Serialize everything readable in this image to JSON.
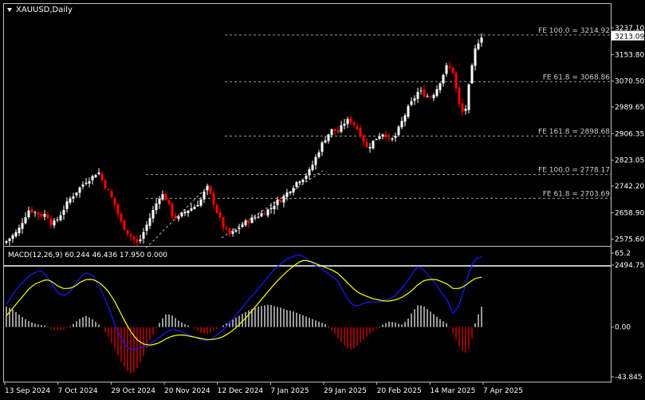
{
  "symbol_label": "XAUUSD,Daily",
  "macd_label": "MACD(12,26,9) 60.244 46.436 17.950 0.000",
  "colors": {
    "background": "#000000",
    "frame": "#c0c0c0",
    "text": "#ffffff",
    "bull_candle": "#ffffff",
    "bear_candle": "#ff0000",
    "fib_line": "#9a9a9a",
    "macd_line": "#1a1aff",
    "signal_line": "#ffff00",
    "hist_positive": "#ffffff",
    "hist_negative": "#ff0000",
    "price_label_bg": "#ffffff",
    "price_label_text": "#000000"
  },
  "chart_data": {
    "type": "candlestick",
    "price_axis": {
      "ticks": [
        "3237.10",
        "3153.80",
        "3070.50",
        "2989.65",
        "2906.35",
        "2823.05",
        "2742.20",
        "2658.90",
        "2575.60",
        "2494.75"
      ],
      "ylim": [
        2494.75,
        3237.1
      ]
    },
    "current_price": "3213.09",
    "x_axis_labels": [
      "13 Sep 2024",
      "7 Oct 2024",
      "29 Oct 2024",
      "20 Nov 2024",
      "12 Dec 2024",
      "7 Jan 2025",
      "29 Jan 2025",
      "20 Feb 2025",
      "14 Mar 2025",
      "7 Apr 2025"
    ],
    "fib_levels": [
      {
        "label": "FE 100.0 = 3214.92",
        "value": 3214.92
      },
      {
        "label": "FE 61.8 = 3068.86",
        "value": 3068.86
      },
      {
        "label": "FE 161.8 = 2898.68",
        "value": 2898.68
      },
      {
        "label": "FE 100.0 = 2778.17",
        "value": 2778.17
      },
      {
        "label": "FE 61.8 = 2703.69",
        "value": 2703.69
      }
    ],
    "close_path": [
      2570,
      2585,
      2600,
      2640,
      2670,
      2660,
      2650,
      2655,
      2620,
      2640,
      2670,
      2700,
      2720,
      2740,
      2760,
      2770,
      2790,
      2750,
      2720,
      2680,
      2630,
      2600,
      2580,
      2560,
      2600,
      2640,
      2680,
      2720,
      2700,
      2650,
      2640,
      2660,
      2670,
      2680,
      2700,
      2740,
      2700,
      2650,
      2610,
      2590,
      2600,
      2620,
      2630,
      2640,
      2650,
      2660,
      2670,
      2690,
      2700,
      2720,
      2740,
      2760,
      2770,
      2790,
      2830,
      2870,
      2900,
      2920,
      2910,
      2940,
      2950,
      2930,
      2900,
      2860,
      2880,
      2900,
      2910,
      2880,
      2900,
      2940,
      2980,
      3010,
      3040,
      3030,
      3020,
      3040,
      3080,
      3120,
      3100,
      3000,
      2960,
      3080,
      3180,
      3213
    ],
    "macd": {
      "ticks": [
        "65.2",
        "0.00",
        "-43.845"
      ],
      "ylim": [
        -43.845,
        65.2
      ],
      "hist_path": [
        18,
        16,
        12,
        8,
        5,
        3,
        2,
        1,
        -2,
        -3,
        -2,
        0,
        4,
        8,
        10,
        7,
        3,
        -2,
        -10,
        -20,
        -30,
        -38,
        -42,
        -35,
        -25,
        -12,
        -3,
        6,
        12,
        10,
        6,
        3,
        1,
        -2,
        -5,
        -6,
        -4,
        -1,
        2,
        5,
        8,
        11,
        14,
        16,
        18,
        19,
        20,
        18,
        17,
        15,
        14,
        12,
        10,
        8,
        6,
        4,
        2,
        -4,
        -10,
        -16,
        -20,
        -18,
        -13,
        -8,
        -4,
        0,
        3,
        5,
        4,
        2,
        6,
        14,
        20,
        18,
        14,
        10,
        6,
        3,
        -6,
        -16,
        -24,
        -18,
        6,
        18
      ],
      "macd_path": [
        20,
        28,
        35,
        40,
        45,
        48,
        50,
        45,
        38,
        30,
        28,
        30,
        38,
        44,
        48,
        46,
        38,
        28,
        15,
        2,
        -10,
        -18,
        -20,
        -19,
        -17,
        -15,
        -12,
        -8,
        -4,
        -2,
        -3,
        -5,
        -7,
        -9,
        -11,
        -12,
        -10,
        -6,
        -2,
        4,
        10,
        16,
        22,
        28,
        34,
        40,
        46,
        52,
        56,
        60,
        62,
        64,
        62,
        58,
        54,
        52,
        48,
        44,
        40,
        30,
        22,
        18,
        20,
        22,
        22,
        22,
        23,
        25,
        28,
        34,
        40,
        48,
        54,
        50,
        44,
        38,
        30,
        24,
        12,
        18,
        34,
        52,
        60,
        62
      ],
      "signal_path": [
        10,
        16,
        22,
        28,
        34,
        38,
        40,
        42,
        40,
        36,
        34,
        34,
        36,
        40,
        42,
        42,
        40,
        36,
        30,
        22,
        12,
        2,
        -6,
        -12,
        -15,
        -16,
        -15,
        -13,
        -10,
        -8,
        -7,
        -7,
        -8,
        -9,
        -10,
        -11,
        -11,
        -10,
        -8,
        -5,
        -1,
        4,
        9,
        15,
        21,
        27,
        33,
        39,
        44,
        49,
        53,
        57,
        59,
        58,
        56,
        54,
        52,
        50,
        47,
        42,
        37,
        32,
        29,
        27,
        25,
        24,
        23,
        23,
        24,
        26,
        29,
        33,
        38,
        41,
        42,
        42,
        40,
        38,
        34,
        34,
        36,
        40,
        43,
        44
      ]
    }
  }
}
